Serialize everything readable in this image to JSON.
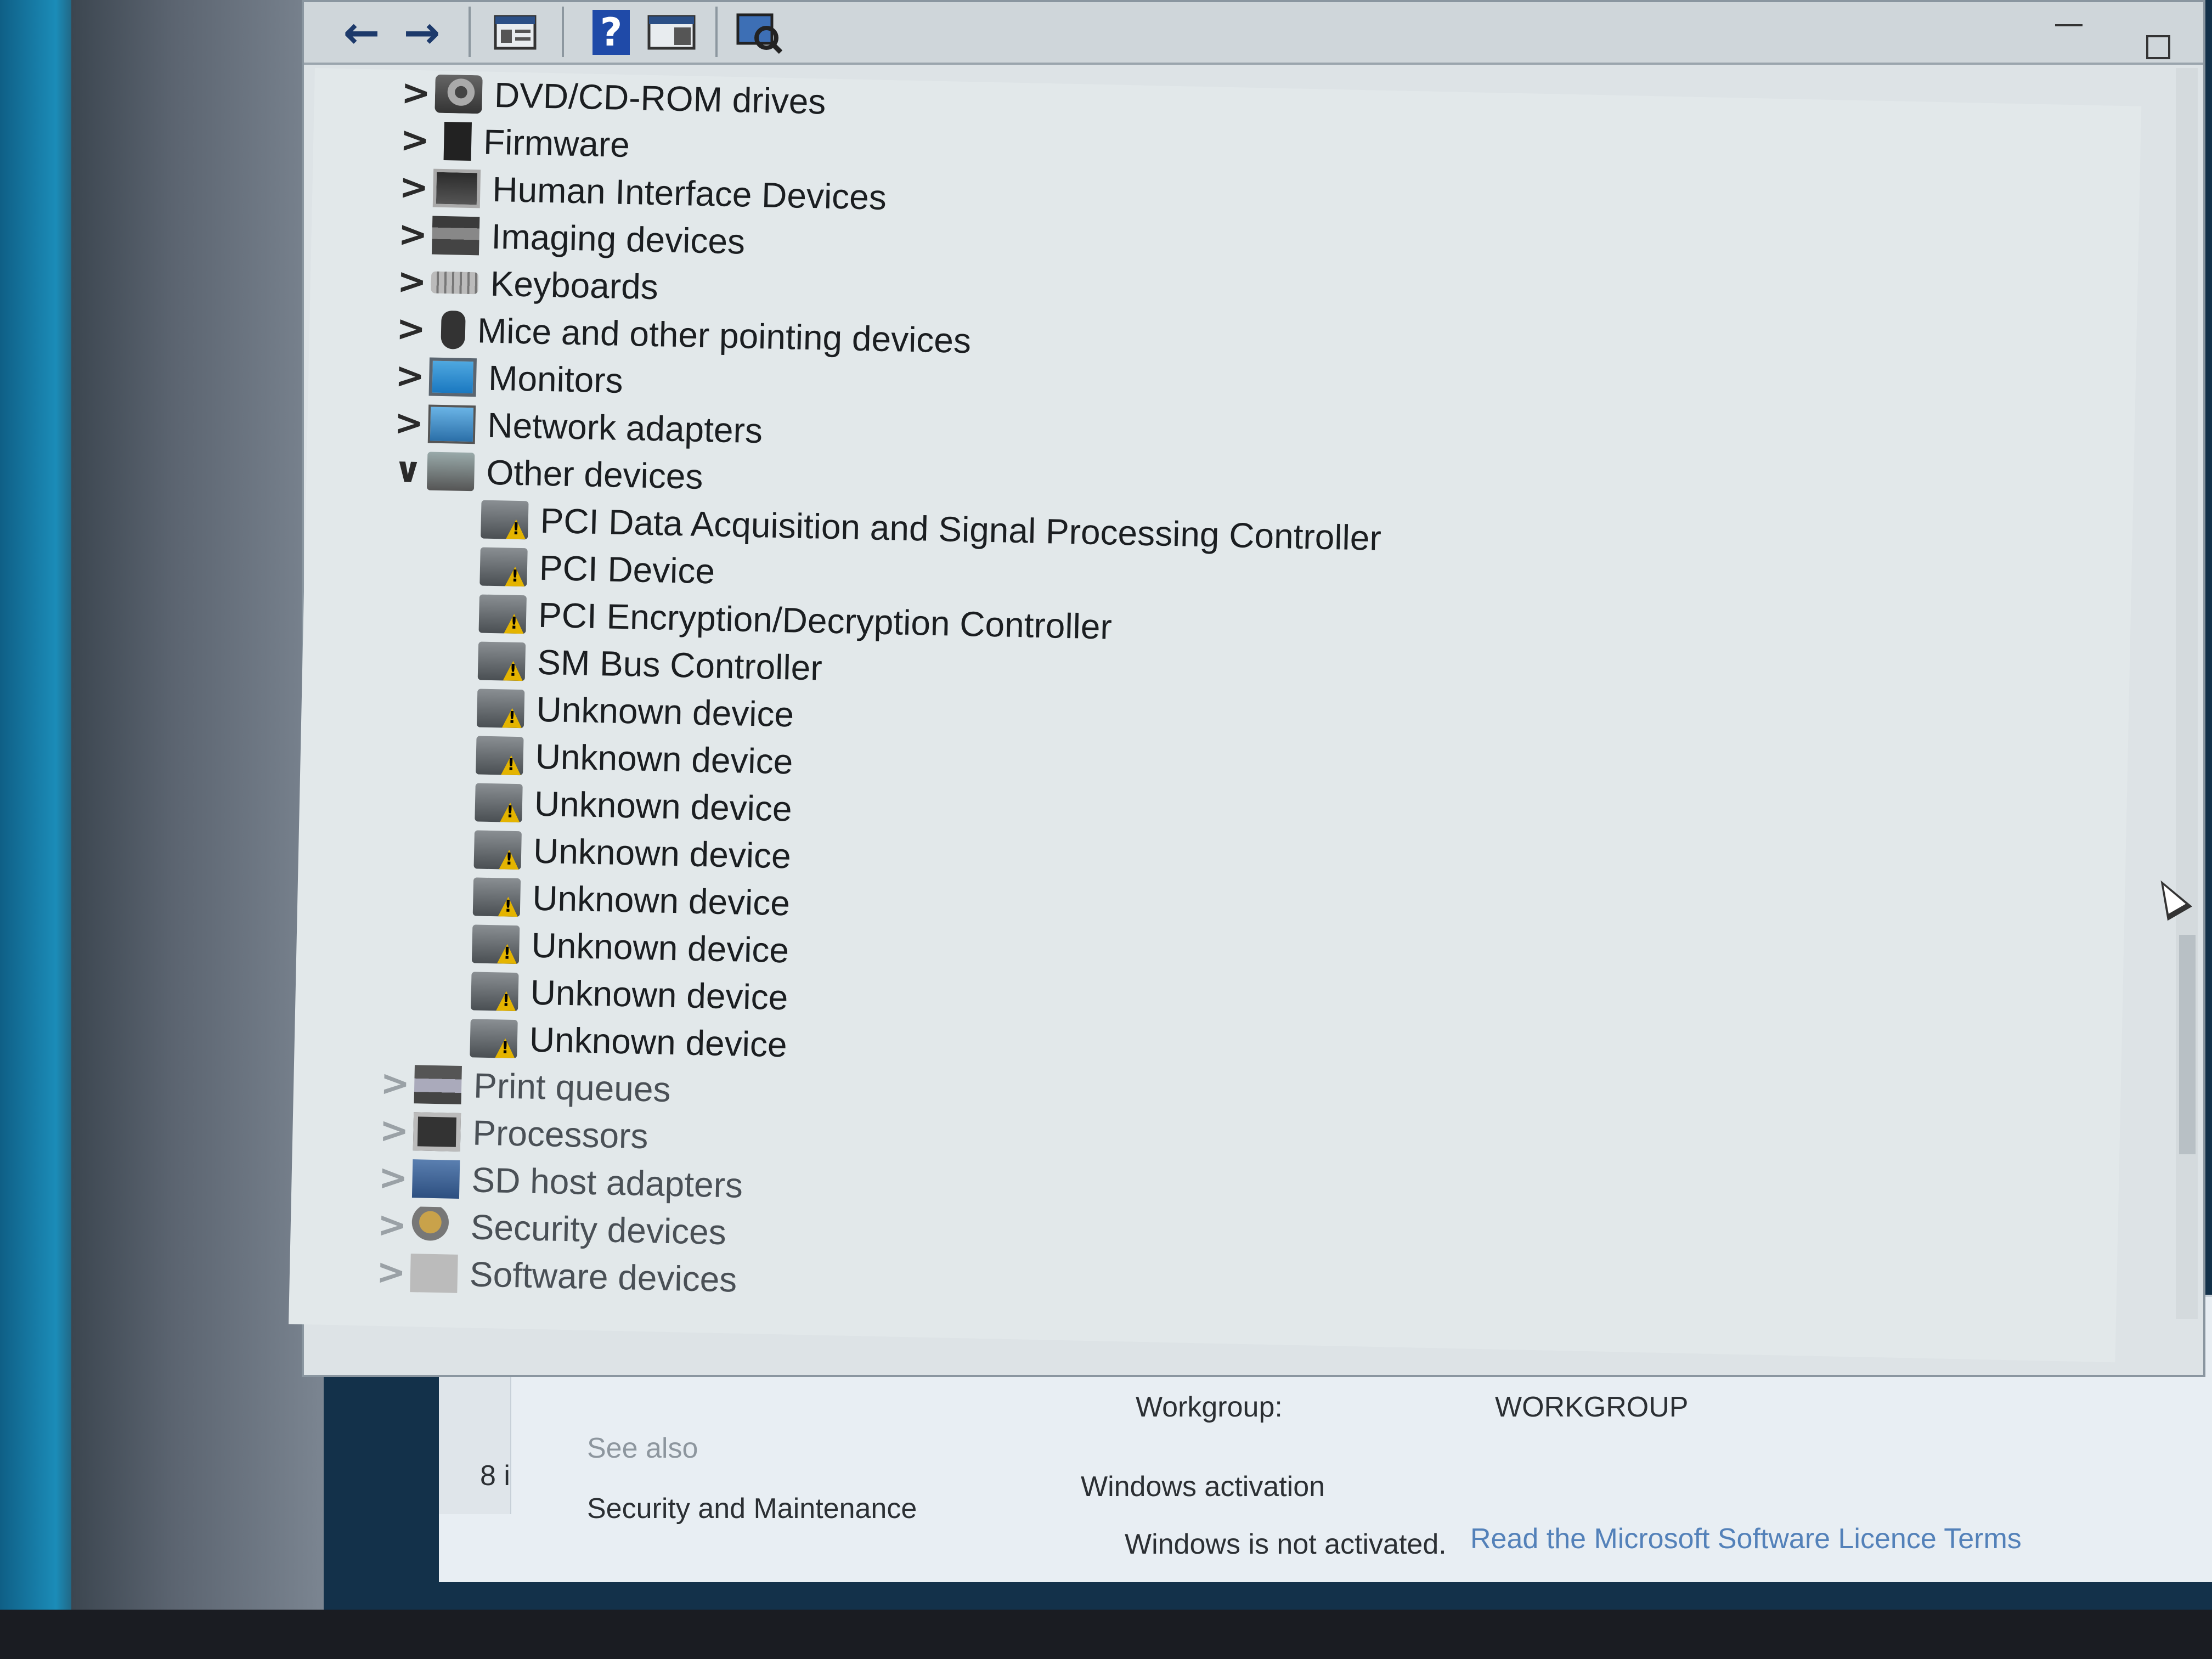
{
  "toolbar": {
    "back_icon": "arrow-left-icon",
    "forward_icon": "arrow-right-icon",
    "properties_icon": "properties-icon",
    "help_glyph": "?",
    "help_icon": "help-icon",
    "view_icon": "view-pane-icon",
    "scan_icon": "scan-hardware-icon"
  },
  "tree": {
    "categories_top": [
      {
        "label": "DVD/CD-ROM drives",
        "icon": "dvd-icon",
        "expanded": false
      },
      {
        "label": "Firmware",
        "icon": "firmware-icon",
        "expanded": false
      },
      {
        "label": "Human Interface Devices",
        "icon": "hid-icon",
        "expanded": false
      },
      {
        "label": "Imaging devices",
        "icon": "camera-icon",
        "expanded": false
      },
      {
        "label": "Keyboards",
        "icon": "keyboard-icon",
        "expanded": false
      },
      {
        "label": "Mice and other pointing devices",
        "icon": "mouse-icon",
        "expanded": false
      },
      {
        "label": "Monitors",
        "icon": "monitor-icon",
        "expanded": false
      },
      {
        "label": "Network adapters",
        "icon": "network-adapter-icon",
        "expanded": false
      },
      {
        "label": "Other devices",
        "icon": "unknown-device-icon",
        "expanded": true
      }
    ],
    "other_devices": [
      "PCI Data Acquisition and Signal Processing Controller",
      "PCI Device",
      "PCI Encryption/Decryption Controller",
      "SM Bus Controller",
      "Unknown device",
      "Unknown device",
      "Unknown device",
      "Unknown device",
      "Unknown device",
      "Unknown device",
      "Unknown device",
      "Unknown device"
    ],
    "categories_bottom": [
      {
        "label": "Print queues",
        "icon": "printer-icon"
      },
      {
        "label": "Processors",
        "icon": "processor-icon"
      },
      {
        "label": "SD host adapters",
        "icon": "sd-adapter-icon"
      },
      {
        "label": "Security devices",
        "icon": "security-key-icon"
      },
      {
        "label": "Software devices",
        "icon": "software-device-icon"
      }
    ],
    "chevron_collapsed": ">",
    "chevron_expanded": "∨"
  },
  "system_window": {
    "workgroup_label": "Workgroup:",
    "workgroup_value": "WORKGROUP",
    "see_also": "See also",
    "security_link": "Security and Maintenance",
    "activation_heading": "Windows activation",
    "activation_status": "Windows is not activated.",
    "licence_link": "Read the Microsoft Software Licence Terms",
    "side_fragment": "8 i"
  }
}
